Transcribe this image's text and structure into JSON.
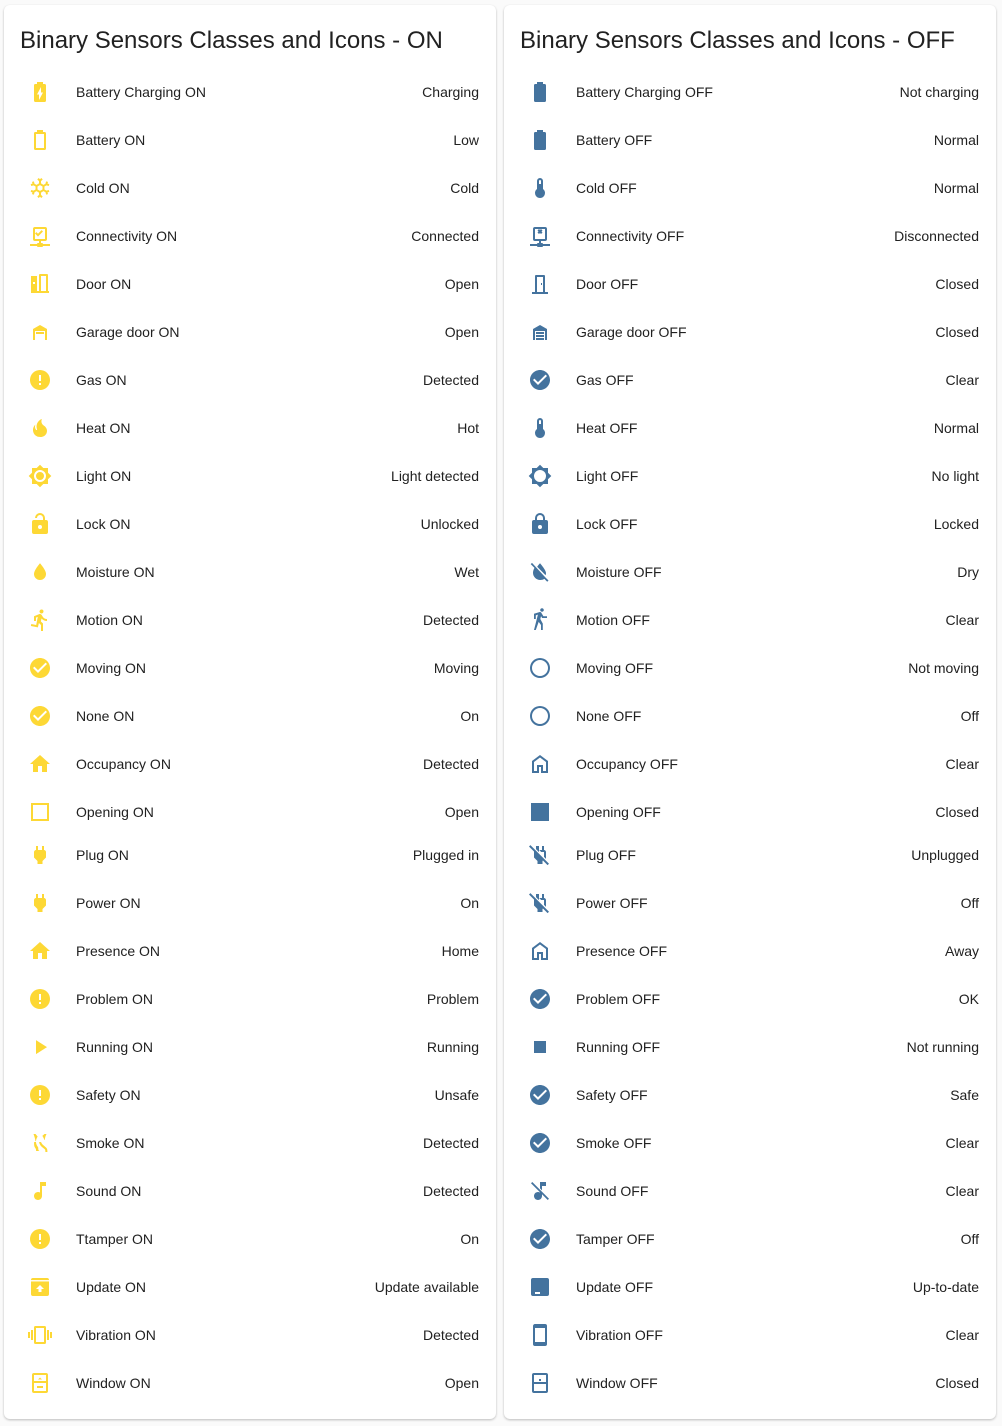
{
  "colors": {
    "on": "#fdd835",
    "off": "#44739e",
    "text": "#212121"
  },
  "cards": [
    {
      "title": "Binary Sensors Classes and Icons - ON",
      "state": "on",
      "rows": [
        {
          "icon": "battery-charging-icon",
          "name": "Battery Charging ON",
          "value": "Charging"
        },
        {
          "icon": "battery-outline-icon",
          "name": "Battery ON",
          "value": "Low"
        },
        {
          "icon": "snowflake-icon",
          "name": "Cold ON",
          "value": "Cold"
        },
        {
          "icon": "network-check-icon",
          "name": "Connectivity ON",
          "value": "Connected"
        },
        {
          "icon": "door-open-icon",
          "name": "Door ON",
          "value": "Open"
        },
        {
          "icon": "garage-open-icon",
          "name": "Garage door ON",
          "value": "Open"
        },
        {
          "icon": "alert-circle-icon",
          "name": "Gas ON",
          "value": "Detected"
        },
        {
          "icon": "fire-icon",
          "name": "Heat ON",
          "value": "Hot"
        },
        {
          "icon": "brightness-icon",
          "name": "Light ON",
          "value": "Light detected"
        },
        {
          "icon": "lock-open-icon",
          "name": "Lock ON",
          "value": "Unlocked"
        },
        {
          "icon": "water-icon",
          "name": "Moisture ON",
          "value": "Wet"
        },
        {
          "icon": "run-icon",
          "name": "Motion ON",
          "value": "Detected"
        },
        {
          "icon": "check-circle-icon",
          "name": "Moving ON",
          "value": "Moving"
        },
        {
          "icon": "check-circle-icon",
          "name": "None ON",
          "value": "On"
        },
        {
          "icon": "home-icon",
          "name": "Occupancy ON",
          "value": "Detected"
        },
        {
          "icon": "square-outline-icon",
          "name": "Opening ON",
          "value": "Open"
        },
        {
          "icon": "power-plug-icon",
          "name": "Plug ON",
          "value": "Plugged in"
        },
        {
          "icon": "power-plug-icon",
          "name": "Power ON",
          "value": "On"
        },
        {
          "icon": "home-icon",
          "name": "Presence ON",
          "value": "Home"
        },
        {
          "icon": "alert-circle-icon",
          "name": "Problem ON",
          "value": "Problem"
        },
        {
          "icon": "play-icon",
          "name": "Running ON",
          "value": "Running"
        },
        {
          "icon": "alert-circle-icon",
          "name": "Safety ON",
          "value": "Unsafe"
        },
        {
          "icon": "smoke-icon",
          "name": "Smoke ON",
          "value": "Detected"
        },
        {
          "icon": "music-note-icon",
          "name": "Sound ON",
          "value": "Detected"
        },
        {
          "icon": "alert-circle-icon",
          "name": "Ttamper ON",
          "value": "On"
        },
        {
          "icon": "package-up-icon",
          "name": "Update ON",
          "value": "Update available"
        },
        {
          "icon": "vibrate-icon",
          "name": "Vibration ON",
          "value": "Detected"
        },
        {
          "icon": "window-open-icon",
          "name": "Window ON",
          "value": "Open"
        }
      ]
    },
    {
      "title": "Binary Sensors Classes and Icons - OFF",
      "state": "off",
      "rows": [
        {
          "icon": "battery-icon",
          "name": "Battery Charging OFF",
          "value": "Not charging"
        },
        {
          "icon": "battery-icon",
          "name": "Battery OFF",
          "value": "Normal"
        },
        {
          "icon": "thermometer-icon",
          "name": "Cold OFF",
          "value": "Normal"
        },
        {
          "icon": "network-off-icon",
          "name": "Connectivity OFF",
          "value": "Disconnected"
        },
        {
          "icon": "door-closed-icon",
          "name": "Door OFF",
          "value": "Closed"
        },
        {
          "icon": "garage-closed-icon",
          "name": "Garage door OFF",
          "value": "Closed"
        },
        {
          "icon": "check-circle-icon",
          "name": "Gas OFF",
          "value": "Clear"
        },
        {
          "icon": "thermometer-icon",
          "name": "Heat OFF",
          "value": "Normal"
        },
        {
          "icon": "brightness-outline-icon",
          "name": "Light OFF",
          "value": "No light"
        },
        {
          "icon": "lock-icon",
          "name": "Lock OFF",
          "value": "Locked"
        },
        {
          "icon": "water-off-icon",
          "name": "Moisture OFF",
          "value": "Dry"
        },
        {
          "icon": "walk-icon",
          "name": "Motion OFF",
          "value": "Clear"
        },
        {
          "icon": "circle-outline-icon",
          "name": "Moving OFF",
          "value": "Not moving"
        },
        {
          "icon": "circle-outline-icon",
          "name": "None OFF",
          "value": "Off"
        },
        {
          "icon": "home-outline-icon",
          "name": "Occupancy OFF",
          "value": "Clear"
        },
        {
          "icon": "square-icon",
          "name": "Opening OFF",
          "value": "Closed"
        },
        {
          "icon": "power-plug-off-icon",
          "name": "Plug OFF",
          "value": "Unplugged"
        },
        {
          "icon": "power-plug-off-icon",
          "name": "Power OFF",
          "value": "Off"
        },
        {
          "icon": "home-outline-icon",
          "name": "Presence OFF",
          "value": "Away"
        },
        {
          "icon": "check-circle-icon",
          "name": "Problem OFF",
          "value": "OK"
        },
        {
          "icon": "stop-icon",
          "name": "Running OFF",
          "value": "Not running"
        },
        {
          "icon": "check-circle-icon",
          "name": "Safety OFF",
          "value": "Safe"
        },
        {
          "icon": "check-circle-icon",
          "name": "Smoke OFF",
          "value": "Clear"
        },
        {
          "icon": "music-note-off-icon",
          "name": "Sound OFF",
          "value": "Clear"
        },
        {
          "icon": "check-circle-icon",
          "name": "Tamper OFF",
          "value": "Off"
        },
        {
          "icon": "package-icon",
          "name": "Update OFF",
          "value": "Up-to-date"
        },
        {
          "icon": "cellphone-icon",
          "name": "Vibration OFF",
          "value": "Clear"
        },
        {
          "icon": "window-closed-icon",
          "name": "Window OFF",
          "value": "Closed"
        }
      ]
    }
  ]
}
